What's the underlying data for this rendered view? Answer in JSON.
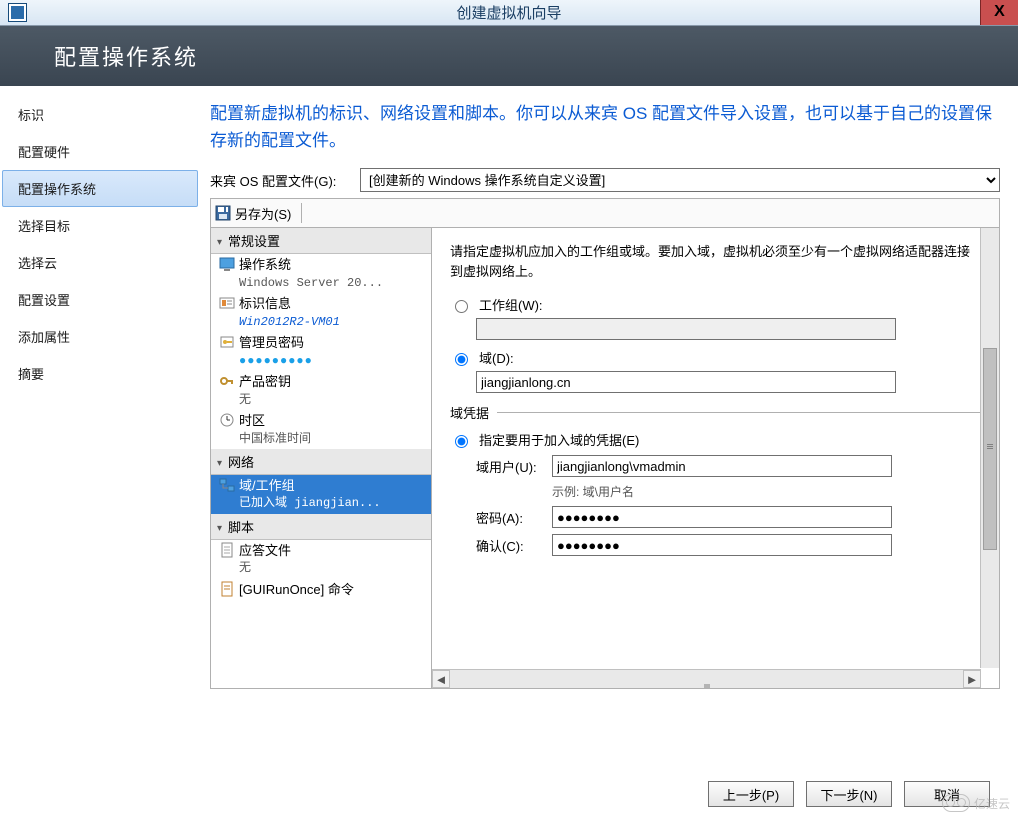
{
  "window": {
    "title": "创建虚拟机向导",
    "close_glyph": "X"
  },
  "header": {
    "title": "配置操作系统"
  },
  "sidebar": {
    "items": [
      {
        "label": "标识"
      },
      {
        "label": "配置硬件"
      },
      {
        "label": "配置操作系统",
        "selected": true
      },
      {
        "label": "选择目标"
      },
      {
        "label": "选择云"
      },
      {
        "label": "配置设置"
      },
      {
        "label": "添加属性"
      },
      {
        "label": "摘要"
      }
    ]
  },
  "intro": "配置新虚拟机的标识、网络设置和脚本。你可以从来宾 OS 配置文件导入设置，也可以基于自己的设置保存新的配置文件。",
  "profile": {
    "label": "来宾 OS 配置文件(G):",
    "selected": "[创建新的 Windows 操作系统自定义设置]"
  },
  "toolbar": {
    "save_as": "另存为(S)"
  },
  "tree": {
    "groups": [
      {
        "title": "常规设置",
        "items": [
          {
            "name": "os",
            "title": "操作系统",
            "sub": "Windows Server 20..."
          },
          {
            "name": "identity",
            "title": "标识信息",
            "sub": "Win2012R2-VM01",
            "sub_style": "link"
          },
          {
            "name": "admin-pw",
            "title": "管理员密码",
            "sub": "●●●●●●●●●",
            "sub_style": "pw"
          },
          {
            "name": "prod-key",
            "title": "产品密钥",
            "sub": "无"
          },
          {
            "name": "timezone",
            "title": "时区",
            "sub": "中国标准时间"
          }
        ]
      },
      {
        "title": "网络",
        "items": [
          {
            "name": "domain-workgroup",
            "title": "域/工作组",
            "sub": "已加入域 jiangjian...",
            "selected": true
          }
        ]
      },
      {
        "title": "脚本",
        "items": [
          {
            "name": "answer-file",
            "title": "应答文件",
            "sub": "无"
          },
          {
            "name": "guirunonce",
            "title": "[GUIRunOnce] 命令",
            "sub": ""
          }
        ]
      }
    ]
  },
  "form": {
    "note": "请指定虚拟机应加入的工作组或域。要加入域，虚拟机必须至少有一个虚拟网络适配器连接到虚拟网络上。",
    "workgroup": {
      "label": "工作组(W):",
      "value": ""
    },
    "domain": {
      "label": "域(D):",
      "value": "jiangjianlong.cn"
    },
    "credentials_section": "域凭据",
    "specify_creds_label": "指定要用于加入域的凭据(E)",
    "domain_user": {
      "label": "域用户(U):",
      "value": "jiangjianlong\\vmadmin",
      "hint": "示例: 域\\用户名"
    },
    "password": {
      "label": "密码(A):",
      "value": "●●●●●●●●"
    },
    "confirm": {
      "label": "确认(C):",
      "value": "●●●●●●●●"
    }
  },
  "footer": {
    "prev": "上一步(P)",
    "next": "下一步(N)",
    "cancel": "取消"
  },
  "watermark": "亿速云"
}
